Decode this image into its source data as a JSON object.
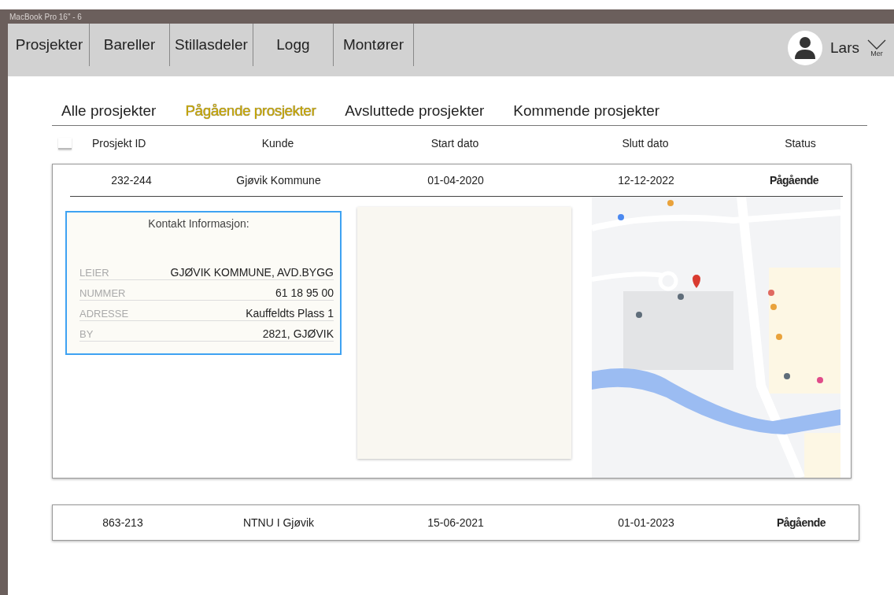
{
  "window": {
    "title": "MacBook Pro 16\" - 6"
  },
  "nav": {
    "items": [
      {
        "label": "Prosjekter"
      },
      {
        "label": "Bareller"
      },
      {
        "label": "Stillasdeler"
      },
      {
        "label": "Logg"
      },
      {
        "label": "Montører"
      }
    ],
    "user": {
      "name": "Lars",
      "menu_label": "Mer"
    }
  },
  "tabs": [
    {
      "label": "Alle prosjekter",
      "selected": false
    },
    {
      "label": "Pågående prosjekter",
      "selected": true
    },
    {
      "label": "Avsluttede prosjekter",
      "selected": false
    },
    {
      "label": "Kommende prosjekter",
      "selected": false
    }
  ],
  "table": {
    "select_all": {
      "checked": false
    },
    "columns": [
      "Prosjekt ID",
      "Kunde",
      "Start dato",
      "Slutt dato",
      "Status"
    ],
    "rows": [
      {
        "id": "232-244",
        "customer": "Gjøvik Kommune",
        "start": "01-04-2020",
        "end": "12-12-2022",
        "status": "Pågående",
        "expanded": true,
        "contact": {
          "title": "Kontakt Informasjon:",
          "fields": [
            {
              "label": "LEIER",
              "value": "GJØVIK KOMMUNE, AVD.BYGG"
            },
            {
              "label": "NUMMER",
              "value": "61 18 95 00"
            },
            {
              "label": "ADRESSE",
              "value": "Kauffeldts Plass 1"
            },
            {
              "label": "BY",
              "value": "2821, GJØVIK"
            }
          ]
        }
      },
      {
        "id": "863-213",
        "customer": "NTNU I Gjøvik",
        "start": "15-06-2021",
        "end": "01-01-2023",
        "status": "Pågående",
        "expanded": false
      }
    ]
  }
}
